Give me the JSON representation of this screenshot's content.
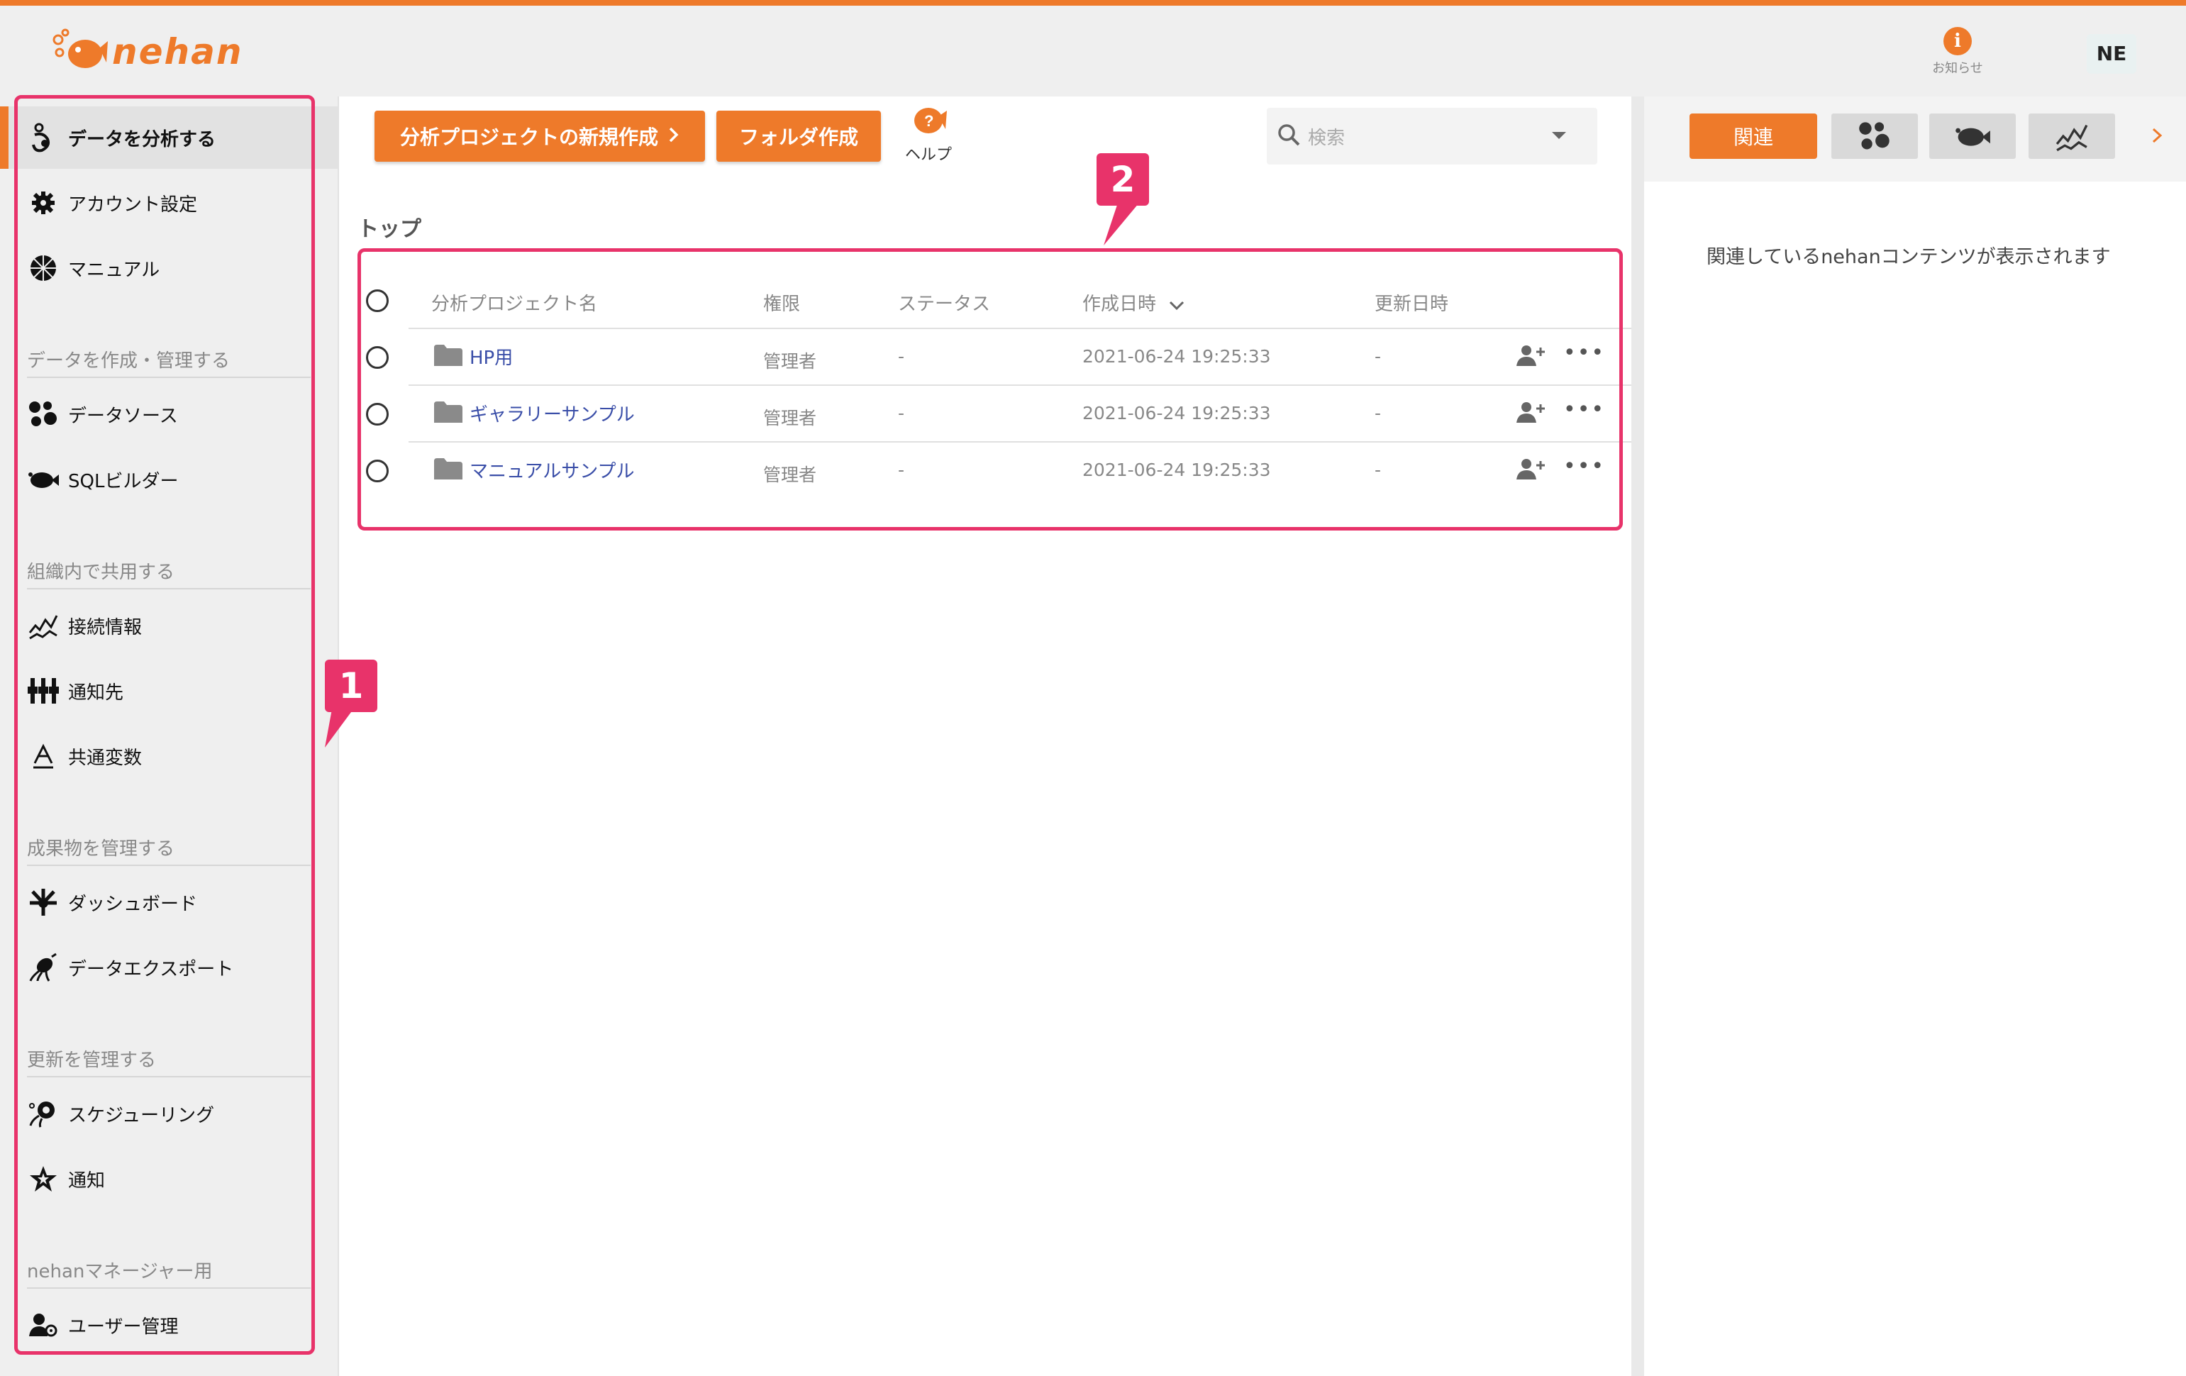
{
  "brand": {
    "logo_text": "nehan",
    "accent": "#ee7a2a",
    "annotation": "#e8336a"
  },
  "header": {
    "notice_label": "お知らせ",
    "notice_icon": "info-icon",
    "avatar_initials": "NE"
  },
  "sidebar": {
    "items": [
      {
        "label": "データを分析する",
        "icon": "analyze-icon",
        "active": true
      },
      {
        "label": "アカウント設定",
        "icon": "gear-icon"
      },
      {
        "label": "マニュアル",
        "icon": "manual-icon"
      }
    ],
    "sections": [
      {
        "title": "データを作成・管理する",
        "items": [
          {
            "label": "データソース",
            "icon": "datasource-icon"
          },
          {
            "label": "SQLビルダー",
            "icon": "sql-builder-icon"
          }
        ]
      },
      {
        "title": "組織内で共用する",
        "items": [
          {
            "label": "接続情報",
            "icon": "connection-icon"
          },
          {
            "label": "通知先",
            "icon": "notification-target-icon"
          },
          {
            "label": "共通変数",
            "icon": "variable-icon"
          }
        ]
      },
      {
        "title": "成果物を管理する",
        "items": [
          {
            "label": "ダッシュボード",
            "icon": "dashboard-icon"
          },
          {
            "label": "データエクスポート",
            "icon": "export-icon"
          }
        ]
      },
      {
        "title": "更新を管理する",
        "items": [
          {
            "label": "スケジューリング",
            "icon": "schedule-icon"
          },
          {
            "label": "通知",
            "icon": "star-icon"
          }
        ]
      },
      {
        "title": "nehanマネージャー用",
        "items": [
          {
            "label": "ユーザー管理",
            "icon": "user-admin-icon"
          }
        ]
      }
    ]
  },
  "toolbar": {
    "new_project_label": "分析プロジェクトの新規作成",
    "new_folder_label": "フォルダ作成",
    "help_label": "ヘルプ",
    "search_placeholder": "検索"
  },
  "breadcrumb": "トップ",
  "table": {
    "columns": [
      "分析プロジェクト名",
      "権限",
      "ステータス",
      "作成日時",
      "更新日時"
    ],
    "rows": [
      {
        "name": "HP用",
        "role": "管理者",
        "status": "-",
        "created": "2021-06-24 19:25:33",
        "updated": "-"
      },
      {
        "name": "ギャラリーサンプル",
        "role": "管理者",
        "status": "-",
        "created": "2021-06-24 19:25:33",
        "updated": "-"
      },
      {
        "name": "マニュアルサンプル",
        "role": "管理者",
        "status": "-",
        "created": "2021-06-24 19:25:33",
        "updated": "-"
      }
    ]
  },
  "right_panel": {
    "tab_label": "関連",
    "message": "関連しているnehanコンテンツが表示されます"
  },
  "annotations": [
    "1",
    "2"
  ]
}
